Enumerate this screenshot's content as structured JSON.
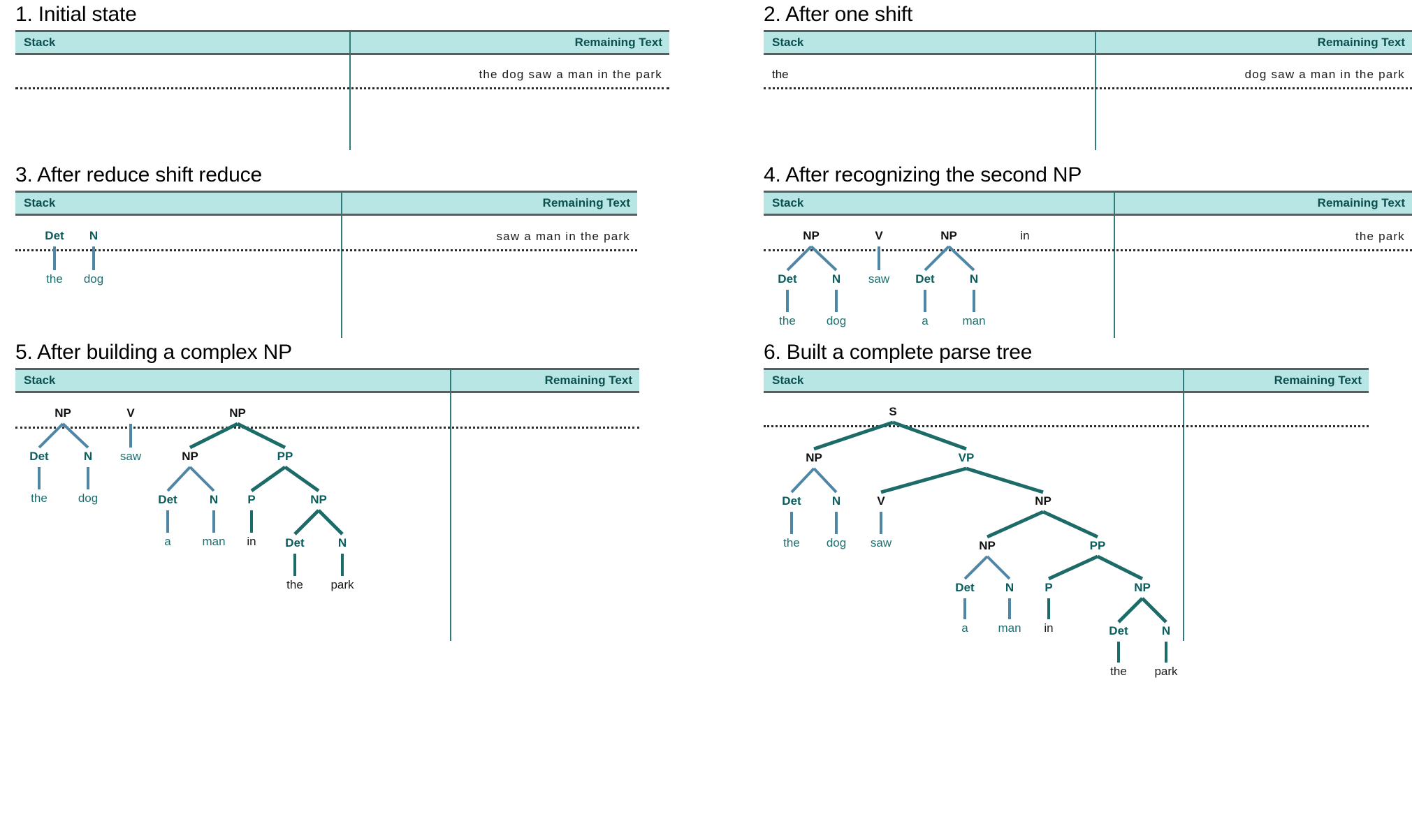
{
  "colors": {
    "header_bg": "#b7e6e4",
    "header_text": "#0b4f4f",
    "rule": "#555f5f",
    "divider": "#2e7d7a",
    "edge_dark": "#1d6b68",
    "edge_light": "#4f86a5",
    "node_teal": "#0b5c5c",
    "node_black": "#111111",
    "leaf_teal": "#1f6e6e",
    "leaf_black": "#1a1a1a",
    "dash": "#2b2b2b"
  },
  "columns": {
    "stack": "Stack",
    "remaining": "Remaining Text"
  },
  "panels": [
    {
      "id": "panel-1",
      "title": "1. Initial state",
      "remaining_text": "the dog saw a man in the park",
      "stack_text": "",
      "trees": []
    },
    {
      "id": "panel-2",
      "title": "2. After one shift",
      "remaining_text": "dog saw a man in the park",
      "stack_text": "the",
      "trees": []
    },
    {
      "id": "panel-3",
      "title": "3. After reduce shift reduce",
      "remaining_text": "saw a man in the park",
      "stack_text": "",
      "trees": [
        {
          "label": "Det",
          "leaf": "the"
        },
        {
          "label": "N",
          "leaf": "dog"
        }
      ]
    },
    {
      "id": "panel-4",
      "title": "4. After recognizing the second NP",
      "remaining_text": "the park",
      "stack_text": "",
      "trees": [
        {
          "label": "NP",
          "children": [
            "Det / the",
            "N / dog"
          ]
        },
        {
          "label": "V",
          "leaf": "saw"
        },
        {
          "label": "NP",
          "children": [
            "Det / a",
            "N / man"
          ]
        },
        {
          "label": "in",
          "bare": true
        }
      ]
    },
    {
      "id": "panel-5",
      "title": "5. After building a complex NP",
      "remaining_text": "",
      "stack_text": "",
      "trees": [
        {
          "label": "NP",
          "children": [
            "Det / the",
            "N / dog"
          ]
        },
        {
          "label": "V",
          "leaf": "saw"
        },
        {
          "label": "NP",
          "children": [
            "NP [Det / a, N / man]",
            "PP [P / in, NP [Det / the, N / park]]"
          ]
        }
      ]
    },
    {
      "id": "panel-6",
      "title": "6. Built a complete parse tree",
      "remaining_text": "",
      "stack_text": "",
      "trees": [
        {
          "label": "S",
          "children": [
            "NP [Det / the, N / dog]",
            "VP [V / saw, NP [NP [Det / a, N / man], PP [P / in, NP [Det / the, N / park]]]]"
          ]
        }
      ]
    }
  ],
  "labels": {
    "S": "S",
    "NP": "NP",
    "VP": "VP",
    "PP": "PP",
    "Det": "Det",
    "N": "N",
    "V": "V",
    "P": "P",
    "in": "in"
  },
  "words": {
    "the": "the",
    "dog": "dog",
    "saw": "saw",
    "a": "a",
    "man": "man",
    "in": "in",
    "park": "park"
  }
}
